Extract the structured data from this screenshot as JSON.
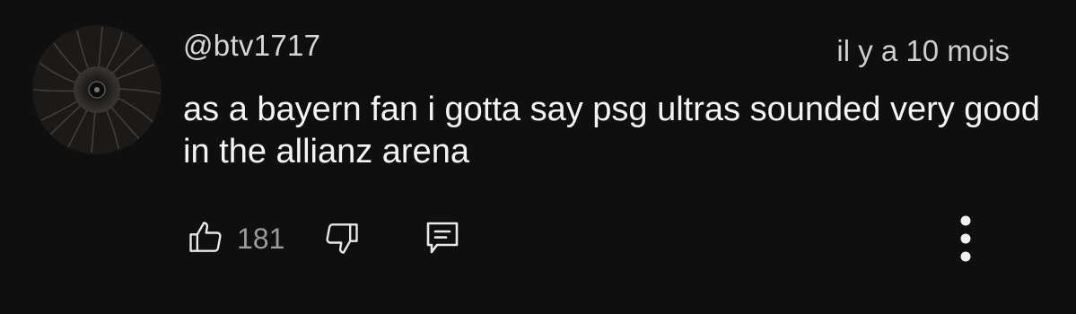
{
  "comment": {
    "author": "@btv1717",
    "timestamp": "il y a 10 mois",
    "text": "as a bayern fan i gotta say psg ultras sounded very good in the allianz arena",
    "like_count": "181"
  },
  "icons": {
    "like": "thumbs-up-icon",
    "dislike": "thumbs-down-icon",
    "reply": "comment-icon",
    "more": "more-vertical-icon"
  },
  "colors": {
    "background": "#0f0f0f",
    "text_primary": "#f1f1f1",
    "text_secondary": "#aaaaaa"
  }
}
